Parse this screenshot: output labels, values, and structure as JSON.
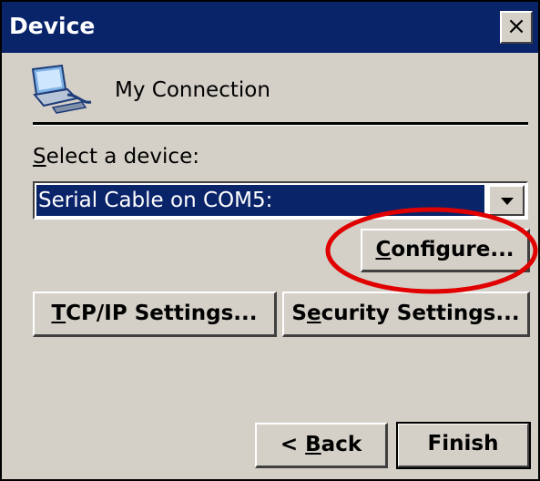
{
  "window": {
    "title": "Device",
    "close_glyph": "×"
  },
  "connection": {
    "icon": "network-connection-icon",
    "name": "My Connection"
  },
  "device_select": {
    "label_mnemonic": "S",
    "label_rest": "elect a device:",
    "selected_value": "Serial Cable on COM5:",
    "dropdown_icon": "chevron-down-icon"
  },
  "buttons": {
    "configure_mnemonic": "C",
    "configure_rest": "onfigure...",
    "tcpip_mnemonic": "T",
    "tcpip_rest": "CP/IP Settings...",
    "security_pre": "S",
    "security_mnemonic": "e",
    "security_rest": "curity Settings...",
    "back_pre": "< ",
    "back_mnemonic": "B",
    "back_rest": "ack",
    "finish": "Finish"
  },
  "colors": {
    "titlebar": "#0a246a",
    "dialog_bg": "#d4d0c8",
    "selection": "#0a246a",
    "highlight_annotation": "#e00000"
  }
}
